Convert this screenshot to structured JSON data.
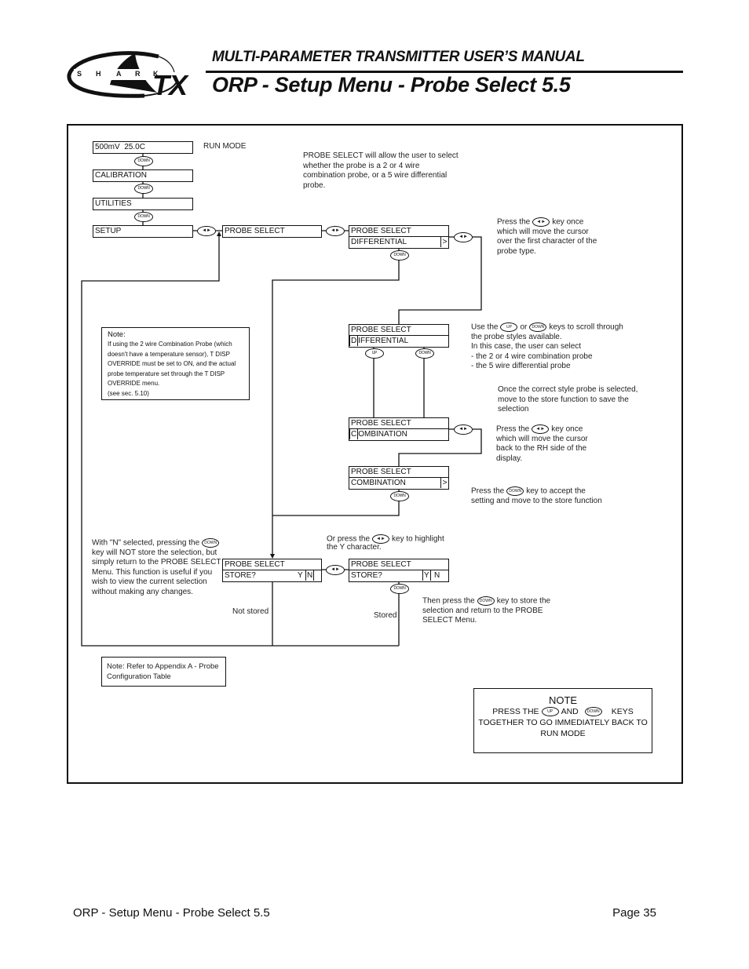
{
  "header": {
    "manual_title": "MULTI-PARAMETER TRANSMITTER USER’S MANUAL",
    "page_title": "ORP - Setup Menu - Probe Select 5.5"
  },
  "logo": {
    "letters": [
      "S",
      "H",
      "A",
      "R",
      "K"
    ],
    "brand": "TX"
  },
  "keys": {
    "down": "DOWN",
    "up": "UP",
    "leftright": "◄►"
  },
  "menu": {
    "run_display": "500mV  25.0C",
    "run_mode_label": "RUN MODE",
    "calibration": "CALIBRATION",
    "utilities": "UTILITIES",
    "setup": "SETUP",
    "probe_select": "PROBE SELECT"
  },
  "screens": {
    "differential": {
      "line1": "PROBE SELECT",
      "line2": "DIFFERENTIAL",
      "indicator": ">"
    },
    "differential_cursor": {
      "line1": "PROBE SELECT",
      "cursor": "D",
      "rest": "IFFERENTIAL"
    },
    "combination_cursor": {
      "line1": "PROBE SELECT",
      "cursor": "C",
      "rest": "OMBINATION"
    },
    "combination": {
      "line1": "PROBE SELECT",
      "line2": "COMBINATION",
      "indicator": ">"
    },
    "store_n": {
      "line1": "PROBE SELECT",
      "line2": "STORE?",
      "y": "Y",
      "n": "N",
      "selected": "N"
    },
    "store_y": {
      "line1": "PROBE SELECT",
      "line2": "STORE?",
      "y": "Y",
      "n": "N",
      "selected": "Y"
    }
  },
  "annotations": {
    "intro": [
      "PROBE SELECT will allow the user to select",
      "whether the probe is a 2 or 4 wire",
      "combination probe, or a 5 wire differential",
      "probe."
    ],
    "cursor_first": {
      "pre": "Press the",
      "post": "key once",
      "lines": [
        "which will move the cursor",
        "over the first character of the",
        "probe type."
      ]
    },
    "scroll": {
      "pre": "Use the",
      "mid": "or",
      "post": "keys to scroll through",
      "lines": [
        "the probe styles available.",
        "In this case, the user can select",
        "- the 2 or 4 wire combination probe",
        "- the 5 wire differential probe"
      ]
    },
    "once_selected": [
      "Once the correct style probe is selected,",
      "move to the store function to save the",
      "selection"
    ],
    "cursor_back": {
      "pre": "Press the",
      "post": "key once",
      "lines": [
        "which will move the cursor",
        "back to the RH side of the",
        "display."
      ]
    },
    "accept": {
      "pre": "Press the",
      "post": "key to accept the",
      "lines": [
        "setting and move to the store function"
      ]
    },
    "n_selected": {
      "pre": "With \"N\" selected, pressing the",
      "lines": [
        "key will NOT store the selection, but",
        "simply return to the PROBE SELECT",
        "Menu. This function is useful if you",
        "wish to view the current selection",
        "without making any changes."
      ]
    },
    "highlight_y": {
      "pre": "Or press the",
      "post": "key to highlight",
      "lines": [
        "the Y character."
      ]
    },
    "store": {
      "pre": "Then press the",
      "post": "key to store the",
      "lines": [
        "selection and return to the PROBE",
        "SELECT Menu."
      ]
    },
    "not_stored": "Not stored",
    "stored": "Stored"
  },
  "notes": {
    "temperature": {
      "title": "Note:",
      "lines": [
        "If using the 2 wire Combination Probe (which",
        "doesn't have a temperature sensor), T DISP",
        "OVERRIDE must be set to ON, and the actual",
        "probe temperature set through the T DISP",
        "OVERRIDE menu.",
        "(see sec. 5.10)"
      ]
    },
    "appendix": [
      "Note: Refer to Appendix A - Probe",
      "Configuration Table"
    ],
    "run_mode": {
      "title": "NOTE",
      "pre": "PRESS THE",
      "mid": "AND",
      "post": "KEYS",
      "lines": [
        "TOGETHER TO GO IMMEDIATELY BACK TO",
        "RUN MODE"
      ]
    }
  },
  "footer": {
    "title": "ORP - Setup Menu - Probe Select 5.5",
    "page": "Page 35"
  }
}
